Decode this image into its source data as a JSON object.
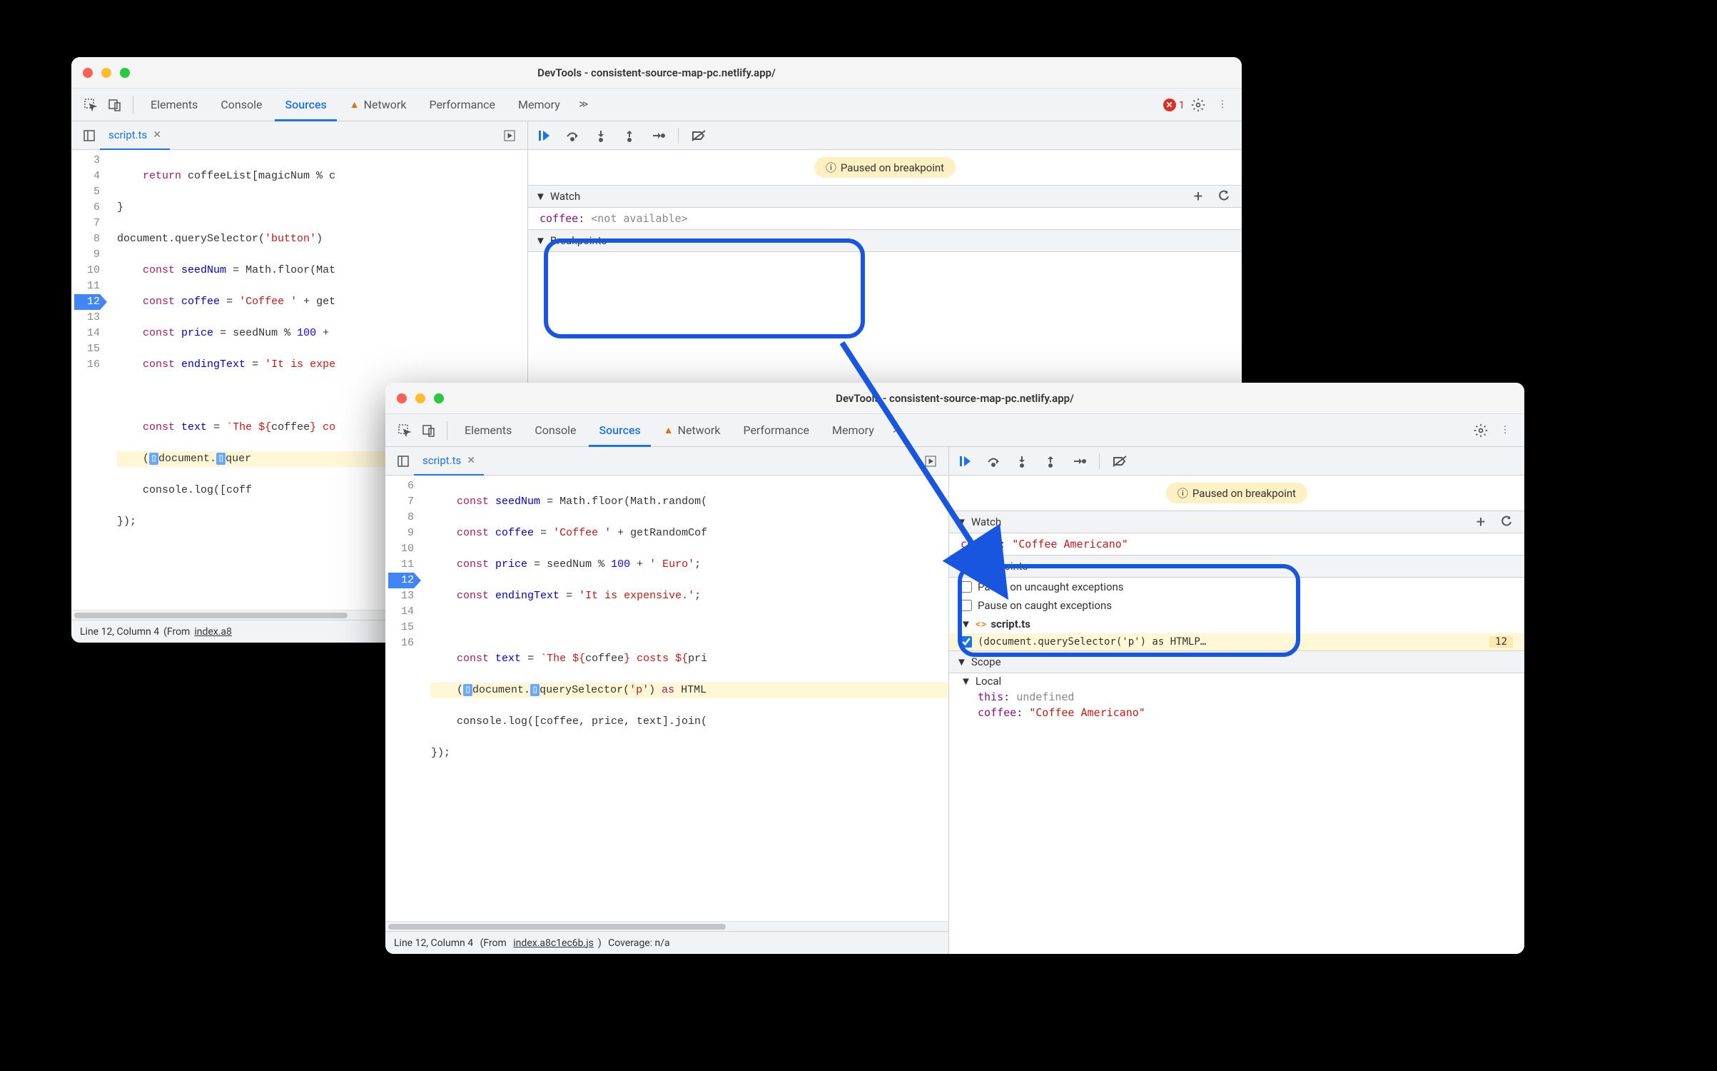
{
  "window1": {
    "title": "DevTools - consistent-source-map-pc.netlify.app/",
    "tabs": [
      "Elements",
      "Console",
      "Sources",
      "Network",
      "Performance",
      "Memory"
    ],
    "activeTab": "Sources",
    "errorCount": "1",
    "fileTab": "script.ts",
    "code": {
      "lines": [
        {
          "n": "3",
          "text": "    return coffeeList[magicNum % c"
        },
        {
          "n": "4",
          "text": "}"
        },
        {
          "n": "5",
          "text": "document.querySelector('button')"
        },
        {
          "n": "6",
          "text": "    const seedNum = Math.floor(Mat"
        },
        {
          "n": "7",
          "text": "    const coffee = 'Coffee ' + get"
        },
        {
          "n": "8",
          "text": "    const price = seedNum % 100 +"
        },
        {
          "n": "9",
          "text": "    const endingText = 'It is expe"
        },
        {
          "n": "10",
          "text": ""
        },
        {
          "n": "11",
          "text": "    const text = `The ${coffee} co"
        },
        {
          "n": "12",
          "text": "    (▯document.▯quer",
          "exec": true
        },
        {
          "n": "13",
          "text": "    console.log([coff"
        },
        {
          "n": "14",
          "text": "});"
        },
        {
          "n": "15",
          "text": ""
        },
        {
          "n": "16",
          "text": ""
        }
      ]
    },
    "status": {
      "pos": "Line 12, Column 4",
      "from": "(From ",
      "file": "index.a8"
    },
    "debug": {
      "pauseMsg": "Paused on breakpoint",
      "watch": {
        "label": "Watch",
        "key": "coffee",
        "val": "<not available>"
      },
      "breakpoints": {
        "label": "Breakpoints"
      }
    }
  },
  "window2": {
    "title": "DevTools - consistent-source-map-pc.netlify.app/",
    "tabs": [
      "Elements",
      "Console",
      "Sources",
      "Network",
      "Performance",
      "Memory"
    ],
    "activeTab": "Sources",
    "fileTab": "script.ts",
    "code": {
      "lines": [
        {
          "n": "6",
          "text": "    const seedNum = Math.floor(Math.random("
        },
        {
          "n": "7",
          "text": "    const coffee = 'Coffee ' + getRandomCof"
        },
        {
          "n": "8",
          "text": "    const price = seedNum % 100 + ' Euro';"
        },
        {
          "n": "9",
          "text": "    const endingText = 'It is expensive.';"
        },
        {
          "n": "10",
          "text": ""
        },
        {
          "n": "11",
          "text": "    const text = `The ${coffee} costs ${pri"
        },
        {
          "n": "12",
          "text": "    (▯document.▯querySelector('p') as HTML",
          "exec": true
        },
        {
          "n": "13",
          "text": "    console.log([coffee, price, text].join("
        },
        {
          "n": "14",
          "text": "});"
        },
        {
          "n": "15",
          "text": ""
        },
        {
          "n": "16",
          "text": ""
        }
      ]
    },
    "status": {
      "pos": "Line 12, Column 4",
      "from": "(From ",
      "file": "index.a8c1ec6b.js",
      ")": " )",
      "coverage": "Coverage: n/a"
    },
    "debug": {
      "pauseMsg": "Paused on breakpoint",
      "watch": {
        "label": "Watch",
        "key": "coffee",
        "val": "\"Coffee Americano\""
      },
      "breakpoints": {
        "label": "Breakpoints",
        "uncaught": "Pause on uncaught exceptions",
        "caught": "Pause on caught exceptions",
        "file": "script.ts",
        "entry": "(document.querySelector('p') as HTMLP…",
        "lineNum": "12"
      },
      "scope": {
        "label": "Scope",
        "local": "Local",
        "thisKey": "this",
        "thisVal": "undefined",
        "coffeeKey": "coffee",
        "coffeeVal": "\"Coffee Americano\""
      }
    }
  }
}
